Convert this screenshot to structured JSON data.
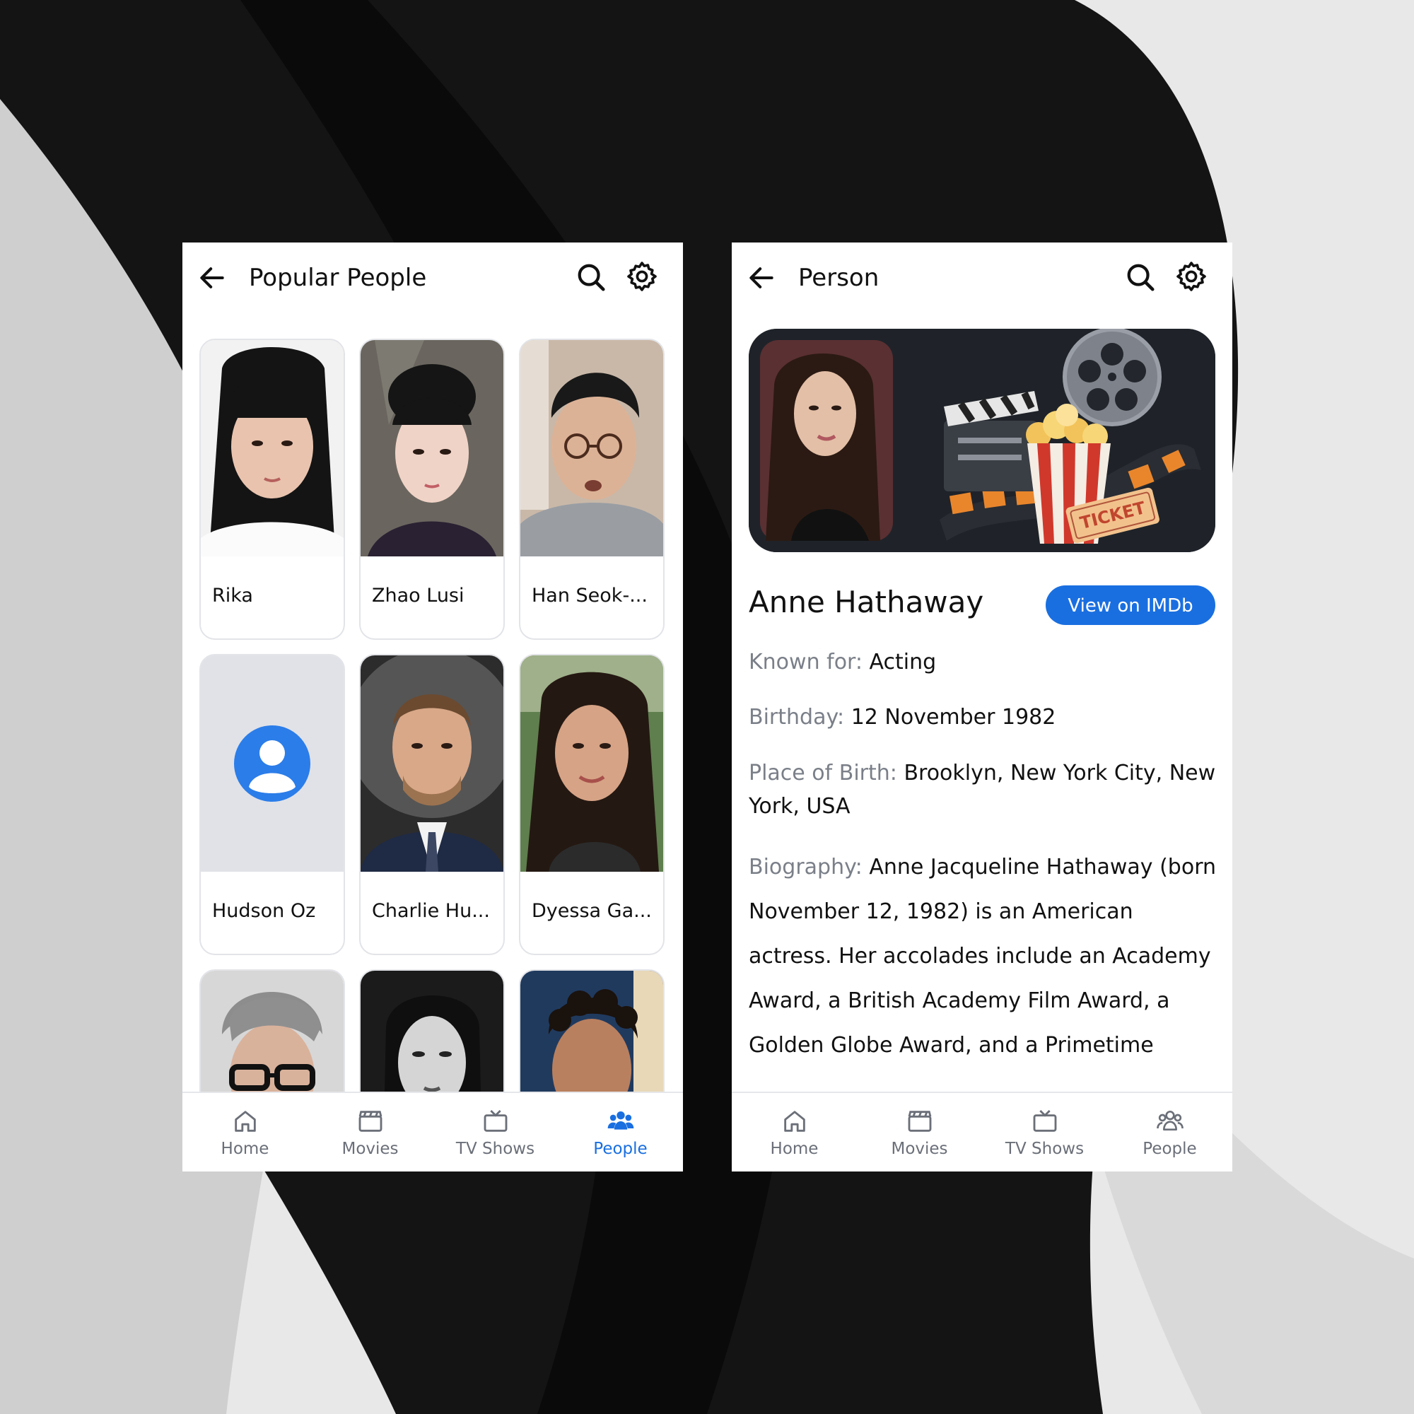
{
  "colors": {
    "accent": "#1a6fe0",
    "muted": "#6b6f78"
  },
  "left_screen": {
    "title": "Popular People",
    "people": [
      {
        "name": "Rika"
      },
      {
        "name": "Zhao Lusi"
      },
      {
        "name": "Han Seok-..."
      },
      {
        "name": "Hudson Oz",
        "placeholder": true
      },
      {
        "name": "Charlie Hu..."
      },
      {
        "name": "Dyessa Ga..."
      },
      {
        "name": ""
      },
      {
        "name": ""
      },
      {
        "name": ""
      }
    ],
    "nav": {
      "home": "Home",
      "movies": "Movies",
      "tv": "TV Shows",
      "people": "People",
      "active": "people"
    }
  },
  "right_screen": {
    "title": "Person",
    "name": "Anne Hathaway",
    "imdb_button": "View on IMDb",
    "hero_ticket_text": "TICKET",
    "known_for_label": "Known for:",
    "known_for": "Acting",
    "birthday_label": "Birthday:",
    "birthday": "12 November 1982",
    "place_label": "Place of Birth:",
    "place": "Brooklyn, New York City, New York, USA",
    "bio_label": "Biography:",
    "bio": "Anne Jacqueline Hathaway (born November 12, 1982) is an American actress. Her accolades include an Academy Award, a British Academy Film Award, a Golden Globe Award, and a Primetime",
    "nav": {
      "home": "Home",
      "movies": "Movies",
      "tv": "TV Shows",
      "people": "People",
      "active": "none"
    }
  }
}
